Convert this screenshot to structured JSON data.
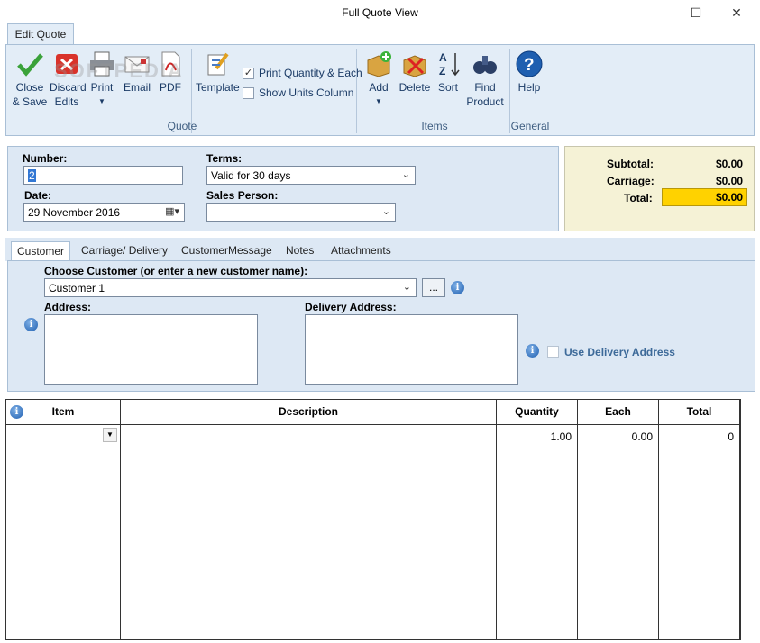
{
  "window": {
    "title": "Full Quote View",
    "minimize": "—",
    "maximize": "☐",
    "close": "✕"
  },
  "ribbon": {
    "tab": "Edit Quote",
    "buttons": {
      "close_save": "Close & Save",
      "discard": "Discard Edits",
      "print": "Print",
      "email": "Email",
      "pdf": "PDF",
      "template": "Template",
      "add": "Add",
      "delete": "Delete",
      "sort": "Sort",
      "find": "Find Product",
      "help": "Help"
    },
    "checks": {
      "print_qty": "Print Quantity & Each",
      "print_qty_checked": true,
      "show_units": "Show Units Column",
      "show_units_checked": false
    },
    "groups": {
      "quote": "Quote",
      "items": "Items",
      "general": "General"
    }
  },
  "header": {
    "number_label": "Number:",
    "number_value": "2",
    "date_label": "Date:",
    "date_value": "29 November  2016",
    "terms_label": "Terms:",
    "terms_value": "Valid for 30 days",
    "salesperson_label": "Sales Person:",
    "salesperson_value": ""
  },
  "totals": {
    "subtotal_label": "Subtotal:",
    "subtotal": "$0.00",
    "carriage_label": "Carriage:",
    "carriage": "$0.00",
    "total_label": "Total:",
    "total": "$0.00",
    "highlight": "#ffd200"
  },
  "tabs": [
    "Customer",
    "Carriage/ Delivery",
    "CustomerMessage",
    "Notes",
    "Attachments"
  ],
  "customer": {
    "choose_label": "Choose Customer (or enter a new customer name):",
    "customer_value": "Customer 1",
    "browse": "...",
    "address_label": "Address:",
    "delivery_label": "Delivery Address:",
    "use_delivery": "Use Delivery Address"
  },
  "grid": {
    "columns": [
      "Item",
      "Description",
      "Quantity",
      "Each",
      "Total"
    ],
    "rows": [
      {
        "item": "",
        "description": "",
        "quantity": "1.00",
        "each": "0.00",
        "total": "0"
      }
    ]
  },
  "watermark": "SOFTPEDIA"
}
